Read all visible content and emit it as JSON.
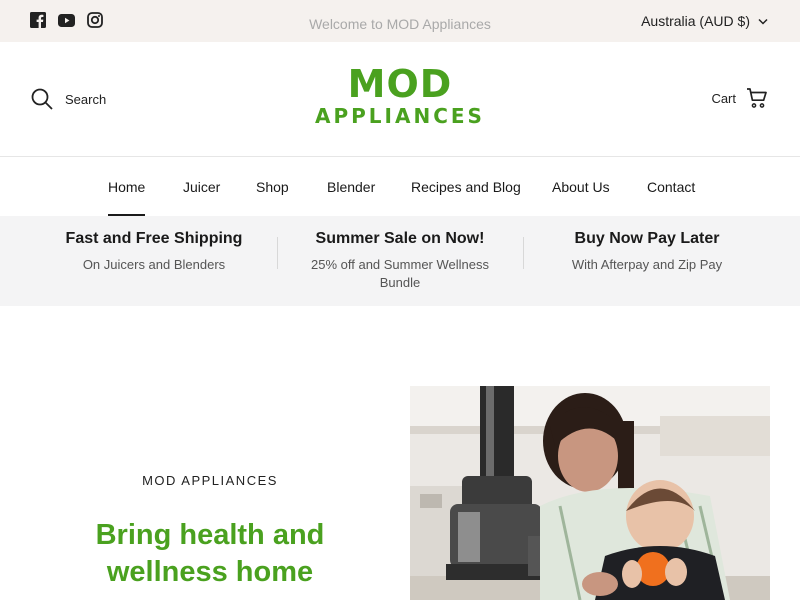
{
  "topbar": {
    "announcement": "Welcome to MOD Appliances",
    "currency": "Australia (AUD $)",
    "social": [
      {
        "icon": "facebook-icon"
      },
      {
        "icon": "youtube-icon"
      },
      {
        "icon": "instagram-icon"
      }
    ]
  },
  "header": {
    "search_label": "Search",
    "logo_line1": "MOD",
    "logo_line2": "APPLIANCES",
    "cart_label": "Cart"
  },
  "nav": {
    "items": [
      {
        "label": "Home",
        "active": true
      },
      {
        "label": "Juicer"
      },
      {
        "label": "Shop"
      },
      {
        "label": "Blender"
      },
      {
        "label": "Recipes and Blog"
      },
      {
        "label": "About Us"
      },
      {
        "label": "Contact"
      }
    ]
  },
  "promos": [
    {
      "title": "Fast and Free Shipping",
      "subtitle": "On Juicers and Blenders"
    },
    {
      "title": "Summer Sale on Now!",
      "subtitle": "25% off and Summer Wellness Bundle"
    },
    {
      "title": "Buy Now Pay Later",
      "subtitle": "With Afterpay and Zip Pay"
    }
  ],
  "hero": {
    "eyebrow": "MOD APPLIANCES",
    "title": "Bring health and wellness home",
    "image": "mother-and-baby-with-juicer-photo"
  },
  "colors": {
    "brand_green": "#4aa11f",
    "topbar_bg": "#f5f1ee",
    "promo_bg": "#f4f4f5"
  }
}
